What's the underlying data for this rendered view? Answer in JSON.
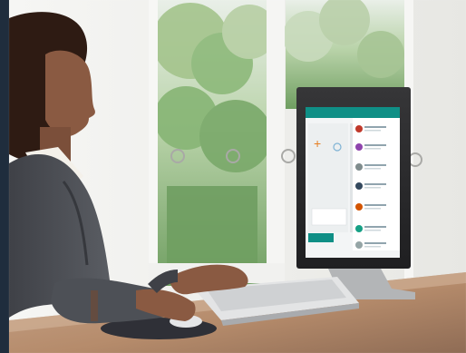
{
  "scene": {
    "description_items": [
      "woman-at-desk",
      "window-with-garden",
      "desktop-monitor",
      "keyboard",
      "mouse-and-mousepad"
    ]
  },
  "monitor_screen": {
    "app_header_color": "#0f8f86",
    "right_panel_items": [
      "",
      "",
      "",
      "",
      "",
      "",
      ""
    ]
  },
  "colors": {
    "border": "#1f2d3d",
    "wall": "#f2f2f0",
    "window_frame": "#f5f5f3",
    "garden_green": "#89b676",
    "monitor_bezel": "#2b2b2c",
    "desk": "#b48d6f",
    "jacket": "#4a4c52",
    "shirt": "#f4f1ea",
    "skin": "#8a5a42",
    "hair": "#2e1b13"
  }
}
